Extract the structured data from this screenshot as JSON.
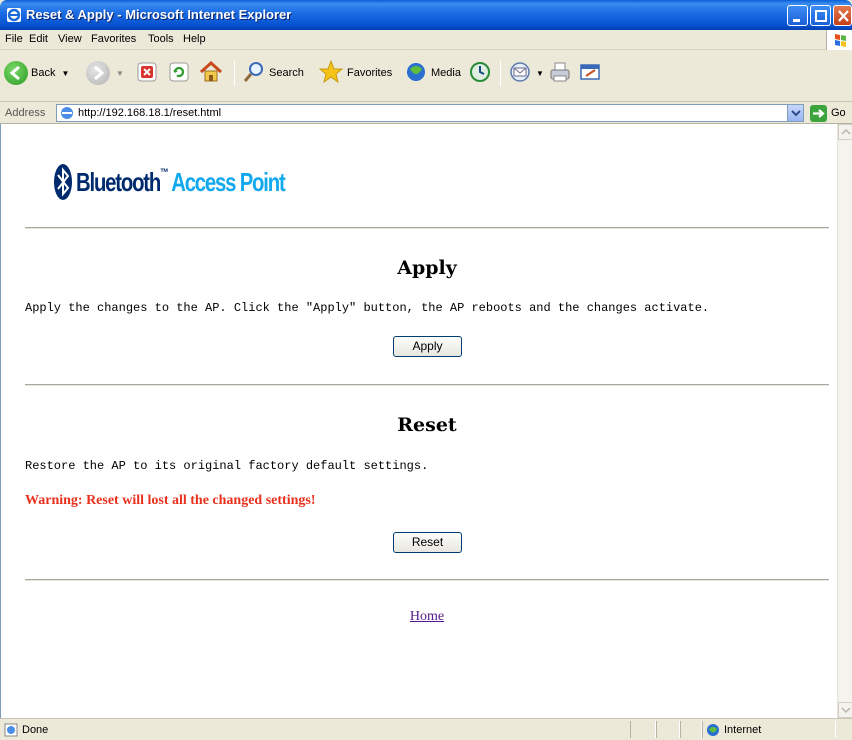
{
  "window": {
    "title": "Reset & Apply - Microsoft Internet Explorer",
    "buttons": [
      "minimize-icon",
      "maximize-icon",
      "close-icon"
    ]
  },
  "menubar": {
    "items": [
      {
        "label": "File"
      },
      {
        "label": "Edit"
      },
      {
        "label": "View"
      },
      {
        "label": "Favorites"
      },
      {
        "label": "Tools"
      },
      {
        "label": "Help"
      }
    ]
  },
  "toolbar": {
    "back_label": "Back",
    "search_label": "Search",
    "favorites_label": "Favorites",
    "media_label": "Media"
  },
  "address": {
    "label": "Address",
    "url": "http://192.168.18.1/reset.html",
    "go_label": "Go"
  },
  "page": {
    "logo": {
      "brand": "Bluetooth",
      "trademark": "™",
      "product": " Access Point"
    },
    "apply": {
      "heading": "Apply",
      "description": "Apply the changes to the AP. Click the \"Apply\" button, the AP reboots and the changes activate.",
      "button_label": "Apply"
    },
    "reset": {
      "heading": "Reset",
      "description": "Restore the AP to its original factory default settings.",
      "warning": "Warning: Reset will lost all the changed settings!",
      "button_label": "Reset"
    },
    "home_link": "Home"
  },
  "statusbar": {
    "status": "Done",
    "zone": "Internet"
  },
  "colors": {
    "warning": "#e8301c",
    "visited_link": "#551a8b",
    "logo_dark": "#002a6e",
    "logo_light": "#11a8ee",
    "titlebar": "#0551cf"
  }
}
